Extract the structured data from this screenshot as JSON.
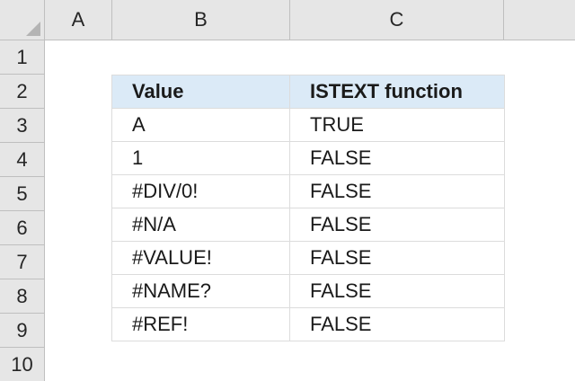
{
  "columns": [
    "A",
    "B",
    "C"
  ],
  "rows": [
    "1",
    "2",
    "3",
    "4",
    "5",
    "6",
    "7",
    "8",
    "9",
    "10"
  ],
  "table": {
    "headers": [
      "Value",
      "ISTEXT function"
    ],
    "rows": [
      [
        "A",
        "TRUE"
      ],
      [
        "1",
        "FALSE"
      ],
      [
        "#DIV/0!",
        "FALSE"
      ],
      [
        "#N/A",
        "FALSE"
      ],
      [
        "#VALUE!",
        "FALSE"
      ],
      [
        "#NAME?",
        "FALSE"
      ],
      [
        "#REF!",
        "FALSE"
      ]
    ]
  },
  "colors": {
    "header_fill": "#dbeaf7",
    "gridline": "#dcdcdc",
    "headings_background": "#e6e6e6"
  }
}
